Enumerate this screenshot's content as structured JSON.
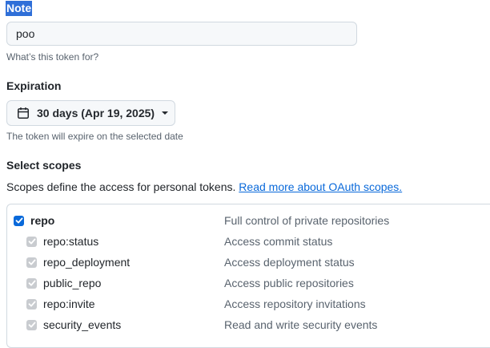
{
  "note": {
    "label": "Note",
    "value": "poo",
    "hint": "What’s this token for?"
  },
  "expiration": {
    "label": "Expiration",
    "selected": "30 days (Apr 19, 2025)",
    "hint": "The token will expire on the selected date"
  },
  "scopes": {
    "label": "Select scopes",
    "description": "Scopes define the access for personal tokens.",
    "link": "Read more about OAuth scopes.",
    "rows": [
      {
        "name": "repo",
        "description": "Full control of private repositories",
        "checked": true,
        "parent": true
      },
      {
        "name": "repo:status",
        "description": "Access commit status",
        "checked": true,
        "parent": false
      },
      {
        "name": "repo_deployment",
        "description": "Access deployment status",
        "checked": true,
        "parent": false
      },
      {
        "name": "public_repo",
        "description": "Access public repositories",
        "checked": true,
        "parent": false
      },
      {
        "name": "repo:invite",
        "description": "Access repository invitations",
        "checked": true,
        "parent": false
      },
      {
        "name": "security_events",
        "description": "Read and write security events",
        "checked": true,
        "parent": false
      }
    ]
  },
  "colors": {
    "accent": "#0969da",
    "selection": "#2f6fd8",
    "disabled_check": "#c9ccd0"
  }
}
